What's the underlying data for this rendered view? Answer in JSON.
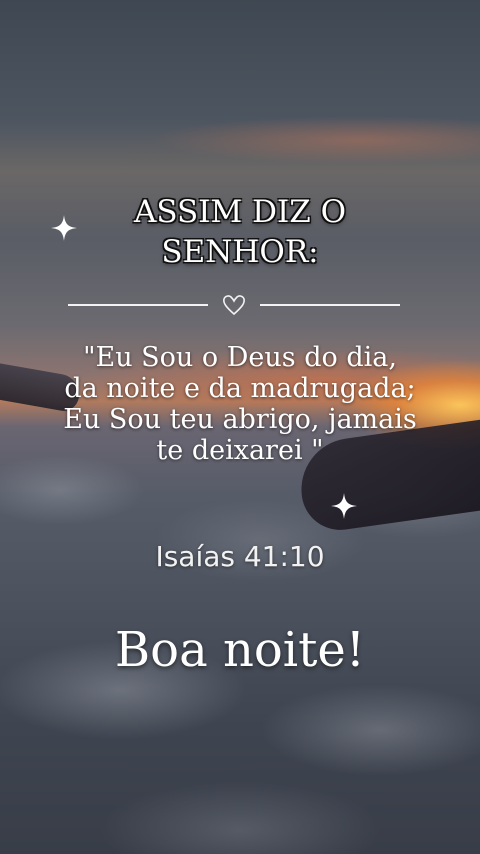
{
  "title": {
    "line1": "ASSIM DIZ O",
    "line2": "SENHOR:"
  },
  "quote": {
    "line1": "\"Eu Sou o Deus do dia,",
    "line2": "da noite e da madrugada;",
    "line3": "Eu Sou teu abrigo, jamais",
    "line4": "te deixarei \""
  },
  "reference": "Isaías 41:10",
  "greeting": "Boa noite!",
  "icons": {
    "sparkle_left": "sparkle-icon",
    "sparkle_right": "sparkle-icon",
    "divider_heart": "heart-outline-icon"
  },
  "colors": {
    "text": "#ffffff",
    "sunset_glow": "#ffb84d"
  }
}
